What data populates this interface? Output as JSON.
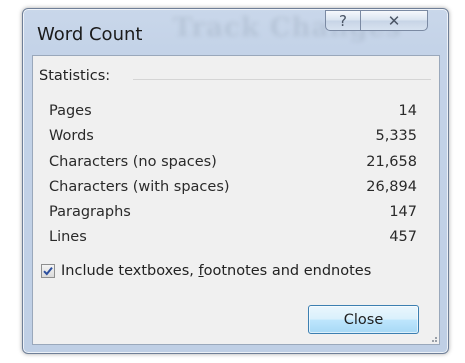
{
  "window": {
    "title": "Word Count",
    "background_title": "Track Changes"
  },
  "titlebar": {
    "help_label": "?",
    "close_glyph": "✕"
  },
  "statistics": {
    "group_label": "Statistics:",
    "rows": [
      {
        "label": "Pages",
        "value": "14"
      },
      {
        "label": "Words",
        "value": "5,335"
      },
      {
        "label": "Characters (no spaces)",
        "value": "21,658"
      },
      {
        "label": "Characters (with spaces)",
        "value": "26,894"
      },
      {
        "label": "Paragraphs",
        "value": "147"
      },
      {
        "label": "Lines",
        "value": "457"
      }
    ]
  },
  "include_option": {
    "label_pre": "Include textboxes, ",
    "label_accel": "f",
    "label_post": "ootnotes and endnotes",
    "checked": true
  },
  "buttons": {
    "close_label": "Close"
  },
  "colors": {
    "titlebar": "#c4d3e8",
    "content_bg": "#f0f0f0",
    "button_border": "#3c7fb1",
    "check_color": "#2c4f9e"
  }
}
